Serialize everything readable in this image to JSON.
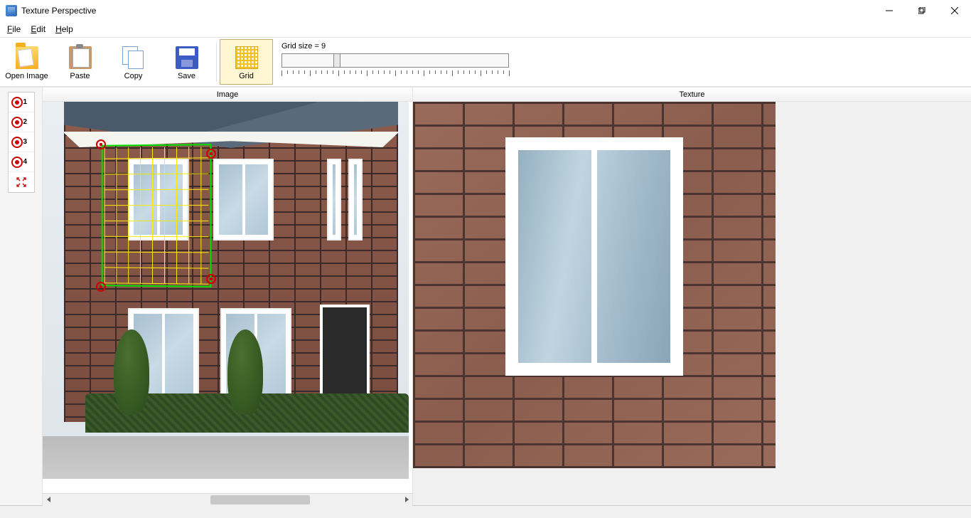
{
  "window": {
    "title": "Texture Perspective"
  },
  "menubar": {
    "file_html": "<u>F</u>ile",
    "edit_html": "<u>E</u>dit",
    "help_html": "<u>H</u>elp"
  },
  "toolbar": {
    "open_image": "Open Image",
    "paste": "Paste",
    "copy": "Copy",
    "save": "Save",
    "grid": "Grid",
    "grid_size_label": "Grid size  =",
    "grid_size_value": "9"
  },
  "side": {
    "points": [
      "1",
      "2",
      "3",
      "4"
    ]
  },
  "panels": {
    "left_title": "Image",
    "right_title": "Texture"
  }
}
